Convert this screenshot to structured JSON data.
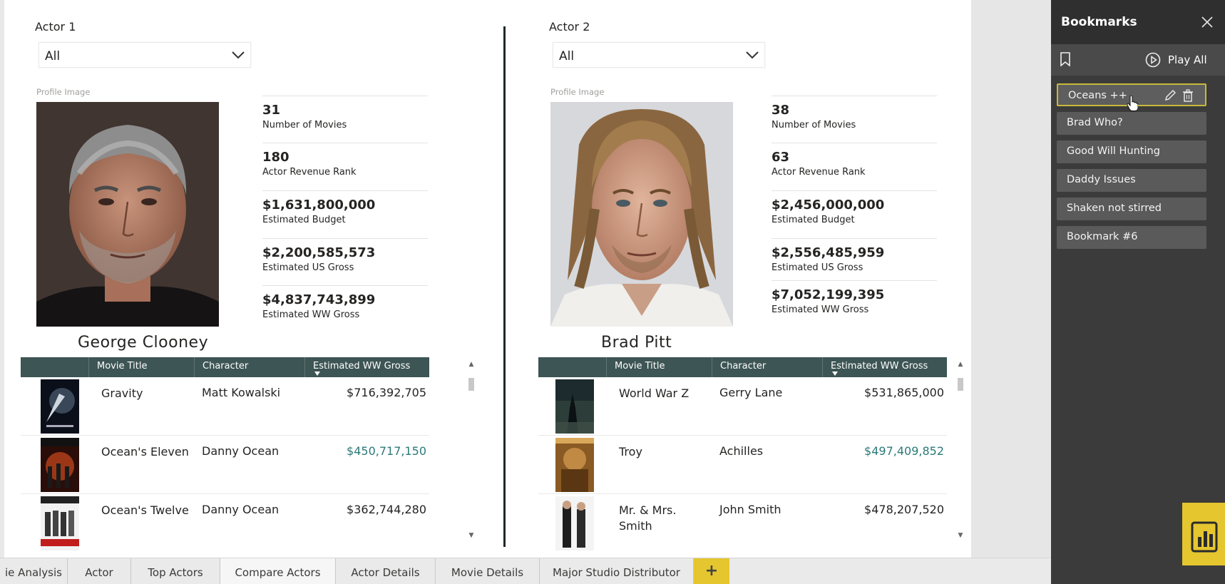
{
  "actor1": {
    "label": "Actor 1",
    "slicer_value": "All",
    "profile_label": "Profile Image",
    "name": "George Clooney",
    "kpis": [
      {
        "value": "31",
        "label": "Number of Movies"
      },
      {
        "value": "180",
        "label": "Actor Revenue Rank"
      },
      {
        "value": "$1,631,800,000",
        "label": "Estimated Budget"
      },
      {
        "value": "$2,200,585,573",
        "label": "Estimated US Gross"
      },
      {
        "value": "$4,837,743,899",
        "label": "Estimated WW Gross"
      }
    ],
    "table": {
      "headers": [
        "Movie Title",
        "Character",
        "Estimated WW Gross"
      ],
      "rows": [
        {
          "title": "Gravity",
          "character": "Matt Kowalski",
          "gross": "$716,392,705"
        },
        {
          "title": "Ocean's Eleven",
          "character": "Danny Ocean",
          "gross": "$450,717,150"
        },
        {
          "title": "Ocean's Twelve",
          "character": "Danny Ocean",
          "gross": "$362,744,280"
        }
      ]
    }
  },
  "actor2": {
    "label": "Actor 2",
    "slicer_value": "All",
    "profile_label": "Profile Image",
    "name": "Brad Pitt",
    "kpis": [
      {
        "value": "38",
        "label": "Number of Movies"
      },
      {
        "value": "63",
        "label": "Actor Revenue Rank"
      },
      {
        "value": "$2,456,000,000",
        "label": "Estimated Budget"
      },
      {
        "value": "$2,556,485,959",
        "label": "Estimated US Gross"
      },
      {
        "value": "$7,052,199,395",
        "label": "Estimated WW Gross"
      }
    ],
    "table": {
      "headers": [
        "Movie Title",
        "Character",
        "Estimated WW Gross"
      ],
      "rows": [
        {
          "title": "World War Z",
          "character": "Gerry Lane",
          "gross": "$531,865,000"
        },
        {
          "title": "Troy",
          "character": "Achilles",
          "gross": "$497,409,852"
        },
        {
          "title": "Mr. & Mrs. Smith",
          "character": "John Smith",
          "gross": "$478,207,520"
        }
      ]
    }
  },
  "tabs": [
    "ie Analysis",
    "Actor",
    "Top Actors",
    "Compare Actors",
    "Actor Details",
    "Movie Details",
    "Major Studio Distributor"
  ],
  "tab_add": "+",
  "bookmarks_pane": {
    "title": "Bookmarks",
    "play_all": "Play All",
    "items": [
      "Oceans ++",
      "Brad Who?",
      "Good Will Hunting",
      "Daddy Issues",
      "Shaken not stirred",
      "Bookmark #6"
    ]
  },
  "colors": {
    "table_header": "#3d5554",
    "highlight_value": "#2b7a78",
    "pane_bg": "#3b3b3b",
    "accent_yellow": "#e5c62f",
    "active_border": "#c8b93a"
  }
}
